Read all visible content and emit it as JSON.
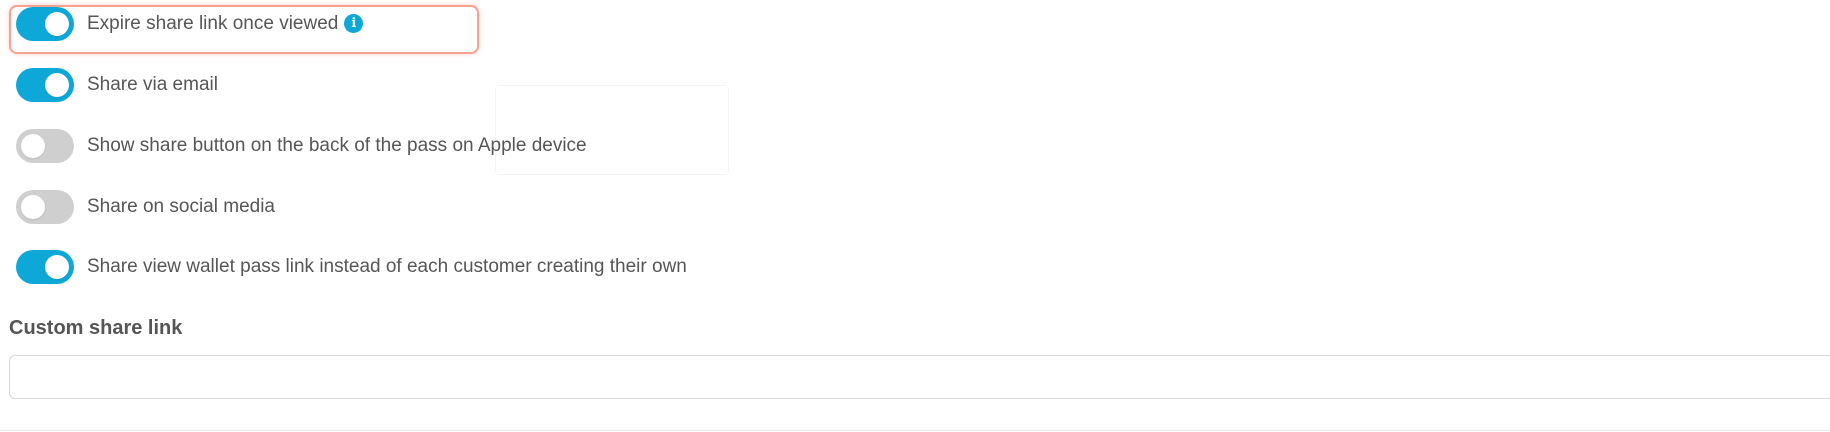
{
  "toggles": [
    {
      "label": "Expire share link once viewed",
      "on": true,
      "has_info_icon": true,
      "highlighted": true
    },
    {
      "label": "Share via email",
      "on": true
    },
    {
      "label": "Show share button on the back of the pass on Apple device",
      "on": false
    },
    {
      "label": "Share on social media",
      "on": false
    },
    {
      "label": "Share view wallet pass link instead of each customer creating their own",
      "on": true
    }
  ],
  "info_icon": {
    "glyph": "i",
    "icon": "info-icon"
  },
  "custom_share_link": {
    "label": "Custom share link",
    "value": ""
  },
  "colors": {
    "toggle_on": "#0ea8d8",
    "toggle_off": "#cfcfcf",
    "highlight_border": "#f5a291",
    "text": "#555555"
  }
}
